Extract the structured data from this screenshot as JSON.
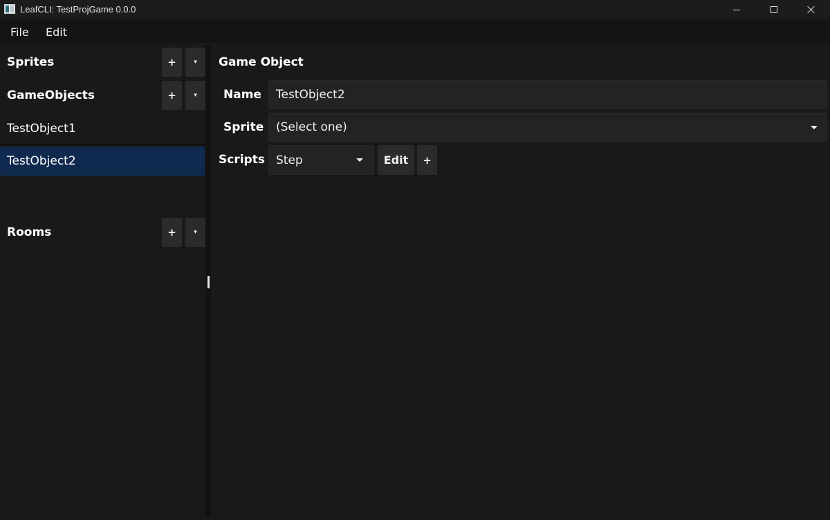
{
  "window": {
    "title": "LeafCLI: TestProjGame 0.0.0"
  },
  "menu": {
    "file": "File",
    "edit": "Edit"
  },
  "sidebar": {
    "sprites": {
      "title": "Sprites",
      "add": "+",
      "dropdown": "▾"
    },
    "gameobjects": {
      "title": "GameObjects",
      "add": "+",
      "dropdown": "▾",
      "items": [
        {
          "label": "TestObject1",
          "selected": false
        },
        {
          "label": "TestObject2",
          "selected": true
        }
      ]
    },
    "rooms": {
      "title": "Rooms",
      "add": "+",
      "dropdown": "▾"
    }
  },
  "editor": {
    "title": "Game Object",
    "name_label": "Name",
    "name_value": "TestObject2",
    "sprite_label": "Sprite",
    "sprite_value": "(Select one)",
    "scripts_label": "Scripts",
    "script_value": "Step",
    "edit_button": "Edit",
    "add_script_button": "+"
  },
  "colors": {
    "background": "#191919",
    "selected_item": "#10294e",
    "button": "#2b2b2e",
    "field": "#232326"
  }
}
